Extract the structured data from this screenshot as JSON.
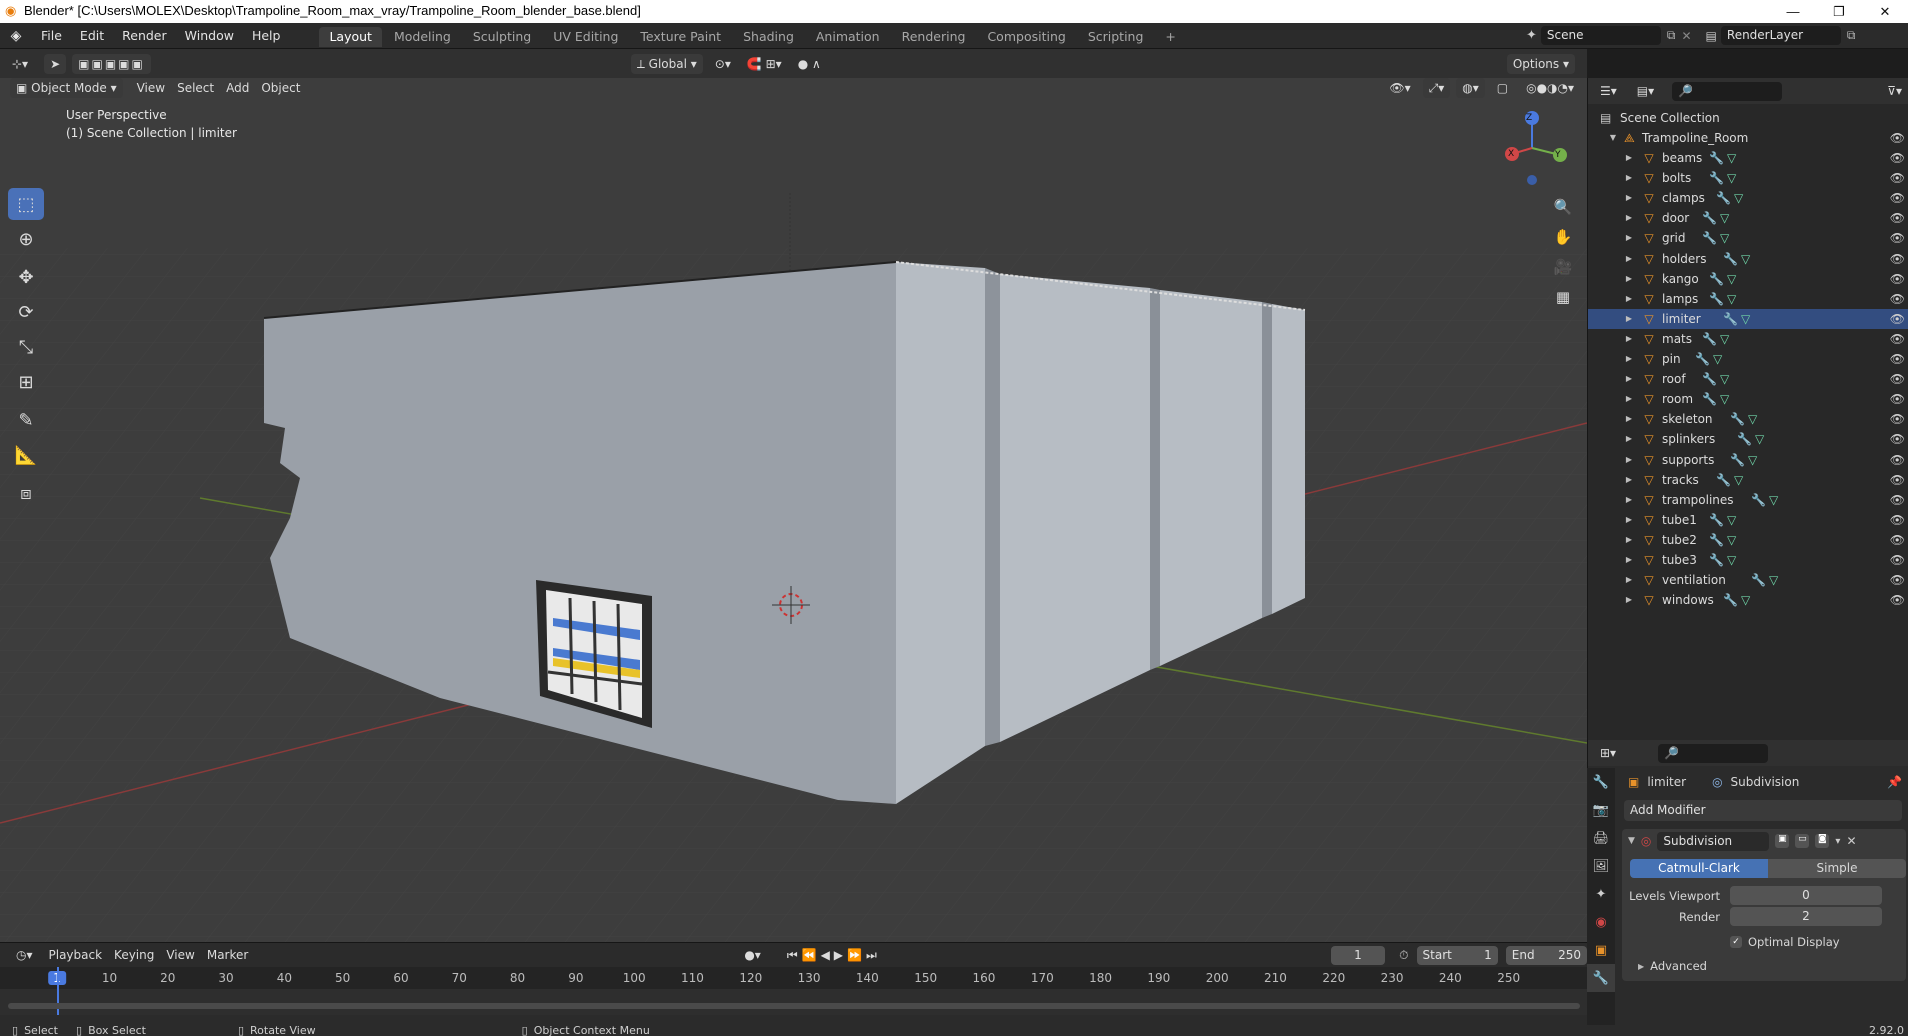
{
  "window": {
    "title": "Blender* [C:\\Users\\MOLEX\\Desktop\\Trampoline_Room_max_vray/Trampoline_Room_blender_base.blend]",
    "minimize": "—",
    "maximize": "❐",
    "close": "✕"
  },
  "menu": [
    "File",
    "Edit",
    "Render",
    "Window",
    "Help"
  ],
  "workspaces": [
    "Layout",
    "Modeling",
    "Sculpting",
    "UV Editing",
    "Texture Paint",
    "Shading",
    "Animation",
    "Rendering",
    "Compositing",
    "Scripting",
    "+"
  ],
  "scene": {
    "name": "Scene",
    "render_layer": "RenderLayer"
  },
  "viewport_header": {
    "mode": "Object Mode",
    "menus": [
      "View",
      "Select",
      "Add",
      "Object"
    ],
    "transform_orientation": "Global",
    "options": "Options"
  },
  "viewport": {
    "perspective": "User Perspective",
    "collection_info": "(1) Scene Collection | limiter",
    "gizmo_x": "X",
    "gizmo_y": "Y",
    "gizmo_z": "Z"
  },
  "outliner": {
    "root": "Scene Collection",
    "collection": "Trampoline_Room",
    "objects": [
      "beams",
      "bolts",
      "clamps",
      "door",
      "grid",
      "holders",
      "kango",
      "lamps",
      "limiter",
      "mats",
      "pin",
      "roof",
      "room",
      "skeleton",
      "splinkers",
      "supports",
      "tracks",
      "trampolines",
      "tube1",
      "tube2",
      "tube3",
      "ventilation",
      "windows"
    ],
    "selected": "limiter"
  },
  "properties": {
    "object": "limiter",
    "modifier_context": "Subdivision",
    "add_modifier": "Add Modifier",
    "modifier_name": "Subdivision",
    "type_a": "Catmull-Clark",
    "type_b": "Simple",
    "levels_viewport_label": "Levels Viewport",
    "levels_viewport": "0",
    "render_label": "Render",
    "render_value": "2",
    "optimal_display": "Optimal Display",
    "advanced": "Advanced"
  },
  "timeline": {
    "menus": [
      "Playback",
      "Keying",
      "View",
      "Marker"
    ],
    "current_frame": "1",
    "start_label": "Start",
    "start": "1",
    "end_label": "End",
    "end": "250",
    "ticks": [
      "1",
      "10",
      "20",
      "30",
      "40",
      "50",
      "60",
      "70",
      "80",
      "90",
      "100",
      "110",
      "120",
      "130",
      "140",
      "150",
      "160",
      "170",
      "180",
      "190",
      "200",
      "210",
      "220",
      "230",
      "240",
      "250"
    ]
  },
  "status": {
    "select": "Select",
    "box_select": "Box Select",
    "rotate_view": "Rotate View",
    "context_menu": "Object Context Menu",
    "version": "2.92.0"
  }
}
